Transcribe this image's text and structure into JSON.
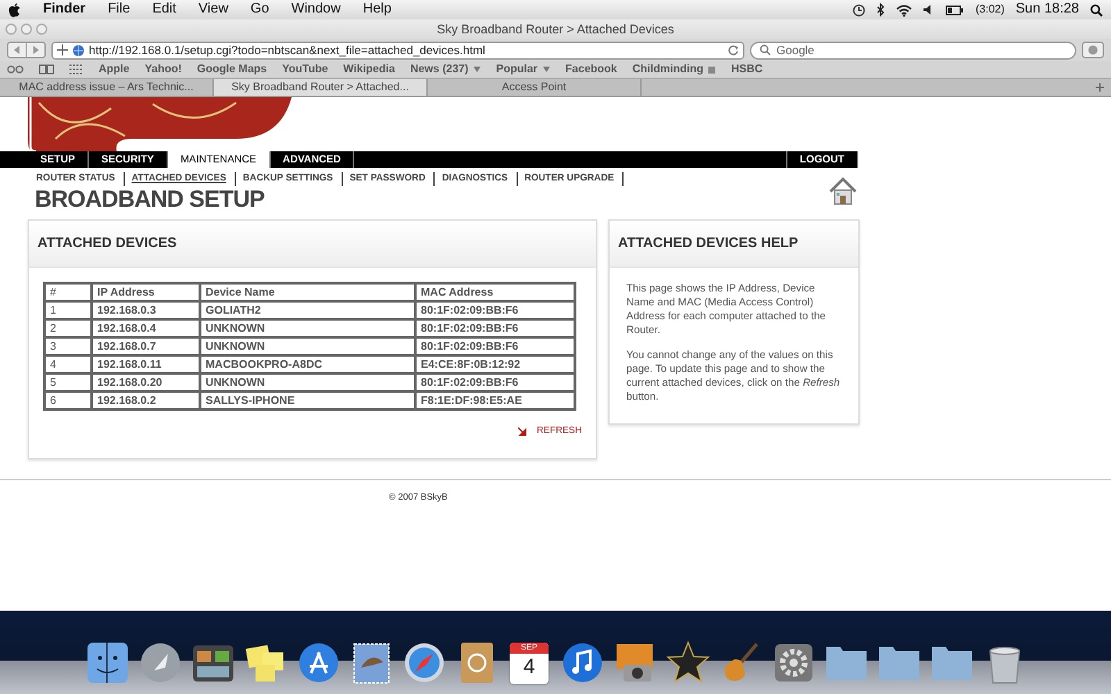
{
  "menubar": {
    "app": "Finder",
    "menus": [
      "File",
      "Edit",
      "View",
      "Go",
      "Window",
      "Help"
    ],
    "battery_time": "(3:02)",
    "clock": "Sun 18:28"
  },
  "browser": {
    "title": "Sky Broadband Router > Attached Devices",
    "url": "http://192.168.0.1/setup.cgi?todo=nbtscan&next_file=attached_devices.html",
    "search_placeholder": "Google",
    "bookmarks": [
      {
        "label": "Apple",
        "kind": "link"
      },
      {
        "label": "Yahoo!",
        "kind": "link"
      },
      {
        "label": "Google Maps",
        "kind": "link"
      },
      {
        "label": "YouTube",
        "kind": "link"
      },
      {
        "label": "Wikipedia",
        "kind": "link"
      },
      {
        "label": "News (237)",
        "kind": "menu"
      },
      {
        "label": "Popular",
        "kind": "menu"
      },
      {
        "label": "Facebook",
        "kind": "link"
      },
      {
        "label": "Childminding",
        "kind": "folder"
      },
      {
        "label": "HSBC",
        "kind": "link"
      }
    ],
    "tabs": [
      {
        "label": "MAC address issue – Ars Technic...",
        "selected": false
      },
      {
        "label": "Sky Broadband Router > Attached...",
        "selected": true
      },
      {
        "label": "Access Point",
        "selected": false
      }
    ]
  },
  "router": {
    "nav": [
      {
        "label": "SETUP",
        "selected": false
      },
      {
        "label": "SECURITY",
        "selected": false
      },
      {
        "label": "MAINTENANCE",
        "selected": true
      },
      {
        "label": "ADVANCED",
        "selected": false
      }
    ],
    "logout": "LOGOUT",
    "subnav": [
      {
        "label": "ROUTER STATUS",
        "selected": false
      },
      {
        "label": "ATTACHED DEVICES",
        "selected": true
      },
      {
        "label": "BACKUP SETTINGS",
        "selected": false
      },
      {
        "label": "SET PASSWORD",
        "selected": false
      },
      {
        "label": "DIAGNOSTICS",
        "selected": false
      },
      {
        "label": "ROUTER UPGRADE",
        "selected": false
      }
    ],
    "heading": "BROADBAND SETUP",
    "panel": {
      "title": "ATTACHED DEVICES",
      "table": {
        "columns": [
          "#",
          "IP Address",
          "Device Name",
          "MAC Address"
        ],
        "rows": [
          [
            "1",
            "192.168.0.3",
            "GOLIATH2",
            "80:1F:02:09:BB:F6"
          ],
          [
            "2",
            "192.168.0.4",
            "UNKNOWN",
            "80:1F:02:09:BB:F6"
          ],
          [
            "3",
            "192.168.0.7",
            "UNKNOWN",
            "80:1F:02:09:BB:F6"
          ],
          [
            "4",
            "192.168.0.11",
            "MACBOOKPRO-A8DC",
            "E4:CE:8F:0B:12:92"
          ],
          [
            "5",
            "192.168.0.20",
            "UNKNOWN",
            "80:1F:02:09:BB:F6"
          ],
          [
            "6",
            "192.168.0.2",
            "SALLYS-IPHONE",
            "F8:1E:DF:98:E5:AE"
          ]
        ]
      },
      "refresh": "REFRESH"
    },
    "help": {
      "title": "ATTACHED DEVICES HELP",
      "paragraphs": [
        "This page shows the IP Address, Device Name and MAC (Media Access Control) Address for each computer attached to the Router.",
        "You cannot change any of the values on this page. To update this page and to show the current attached devices, click on the *Refresh* button."
      ]
    },
    "footer": "© 2007 BSkyB"
  },
  "dock": {
    "items": [
      {
        "kind": "finder"
      },
      {
        "kind": "rocket"
      },
      {
        "kind": "windows"
      },
      {
        "kind": "notes"
      },
      {
        "kind": "store"
      },
      {
        "kind": "stamp"
      },
      {
        "kind": "compass"
      },
      {
        "kind": "book"
      },
      {
        "kind": "calendar",
        "month": "SEP",
        "day": "4"
      },
      {
        "kind": "music"
      },
      {
        "kind": "photo"
      },
      {
        "kind": "star"
      },
      {
        "kind": "guitar"
      },
      {
        "kind": "gear"
      },
      {
        "kind": "folder"
      },
      {
        "kind": "folder"
      },
      {
        "kind": "folder"
      },
      {
        "kind": "trash"
      }
    ]
  }
}
